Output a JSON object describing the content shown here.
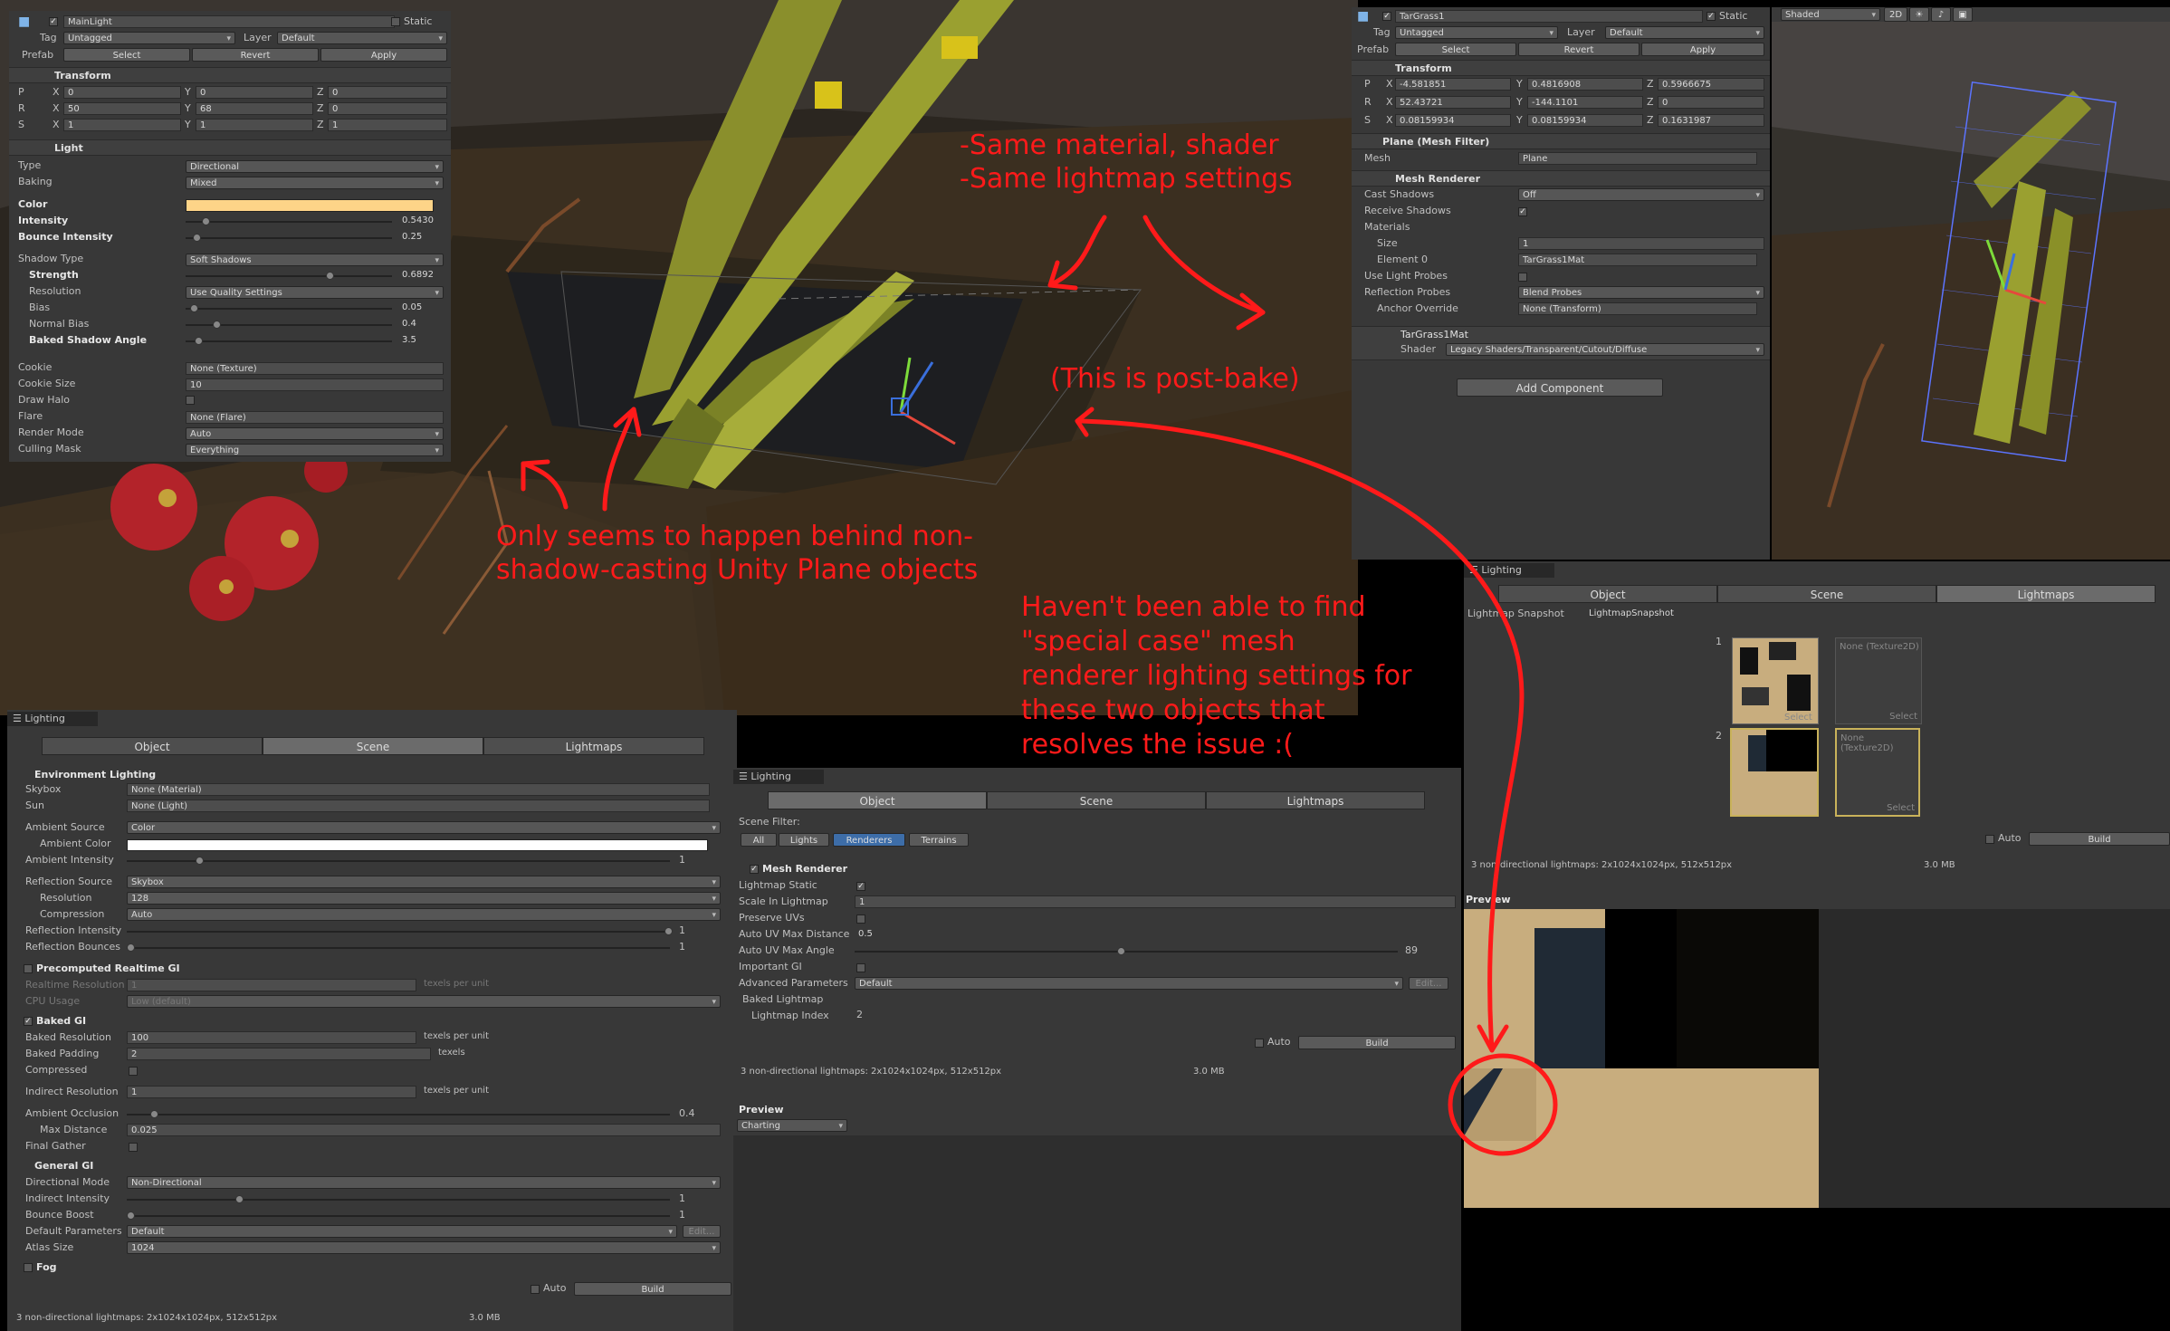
{
  "colors": {
    "annotation": "#ff1a1a",
    "light_color": "#fdd488",
    "panel": "#383838"
  },
  "main_light": {
    "name": "MainLight",
    "static": "Static",
    "tag_label": "Tag",
    "tag": "Untagged",
    "layer_label": "Layer",
    "layer": "Default",
    "prefab_label": "Prefab",
    "select": "Select",
    "revert": "Revert",
    "apply": "Apply",
    "transform_title": "Transform",
    "p": [
      "P",
      "X",
      "0",
      "Y",
      "0",
      "Z",
      "0"
    ],
    "r": [
      "R",
      "X",
      "50",
      "Y",
      "68",
      "Z",
      "0"
    ],
    "s": [
      "S",
      "X",
      "1",
      "Y",
      "1",
      "Z",
      "1"
    ],
    "light_title": "Light",
    "type_label": "Type",
    "type": "Directional",
    "baking_label": "Baking",
    "baking": "Mixed",
    "color_label": "Color",
    "intensity_label": "Intensity",
    "intensity": "0.5430",
    "bounce_label": "Bounce Intensity",
    "bounce": "0.25",
    "shadow_type_label": "Shadow Type",
    "shadow_type": "Soft Shadows",
    "strength_label": "Strength",
    "strength": "0.6892",
    "resolution_label": "Resolution",
    "resolution": "Use Quality Settings",
    "bias_label": "Bias",
    "bias": "0.05",
    "normal_bias_label": "Normal Bias",
    "normal_bias": "0.4",
    "baked_angle_label": "Baked Shadow Angle",
    "baked_angle": "3.5",
    "cookie_label": "Cookie",
    "cookie": "None (Texture)",
    "cookie_size_label": "Cookie Size",
    "cookie_size": "10",
    "draw_halo_label": "Draw Halo",
    "flare_label": "Flare",
    "flare": "None (Flare)",
    "render_mode_label": "Render Mode",
    "render_mode": "Auto",
    "culling_label": "Culling Mask",
    "culling": "Everything"
  },
  "tar_grass": {
    "name": "TarGrass1",
    "static": "Static",
    "tag_label": "Tag",
    "tag": "Untagged",
    "layer_label": "Layer",
    "layer": "Default",
    "prefab_label": "Prefab",
    "select": "Select",
    "revert": "Revert",
    "apply": "Apply",
    "transform_title": "Transform",
    "p": [
      "P",
      "X",
      "-4.581851",
      "Y",
      "0.4816908",
      "Z",
      "0.5966675"
    ],
    "r": [
      "R",
      "X",
      "52.43721",
      "Y",
      "-144.1101",
      "Z",
      "0"
    ],
    "s": [
      "S",
      "X",
      "0.08159934",
      "Y",
      "0.08159934",
      "Z",
      "0.1631987"
    ],
    "mesh_filter_title": "Plane (Mesh Filter)",
    "mesh_label": "Mesh",
    "mesh": "Plane",
    "renderer_title": "Mesh Renderer",
    "cast_label": "Cast Shadows",
    "cast": "Off",
    "receive_label": "Receive Shadows",
    "materials_label": "Materials",
    "size_label": "Size",
    "size": "1",
    "element_label": "Element 0",
    "element": "TarGrass1Mat",
    "light_probes_label": "Use Light Probes",
    "refl_probes_label": "Reflection Probes",
    "refl_probes": "Blend Probes",
    "anchor_label": "Anchor Override",
    "anchor": "None (Transform)",
    "material_name": "TarGrass1Mat",
    "shader_label": "Shader",
    "shader": "Legacy Shaders/Transparent/Cutout/Diffuse",
    "add_component": "Add Component"
  },
  "scene_view": {
    "shaded": "Shaded",
    "mode_2d": "2D"
  },
  "lighting_scene": {
    "title": "Lighting",
    "tabs": [
      "Object",
      "Scene",
      "Lightmaps"
    ],
    "env_title": "Environment Lighting",
    "skybox_label": "Skybox",
    "skybox": "None (Material)",
    "sun_label": "Sun",
    "sun": "None (Light)",
    "amb_source_label": "Ambient Source",
    "amb_source": "Color",
    "amb_color_label": "Ambient Color",
    "amb_intensity_label": "Ambient Intensity",
    "amb_intensity": "1",
    "refl_source_label": "Reflection Source",
    "refl_source": "Skybox",
    "refl_res_label": "Resolution",
    "refl_res": "128",
    "compression_label": "Compression",
    "compression": "Auto",
    "refl_intensity_label": "Reflection Intensity",
    "refl_intensity": "1",
    "refl_bounces_label": "Reflection Bounces",
    "refl_bounces": "1",
    "precomp_title": "Precomputed Realtime GI",
    "rt_res_label": "Realtime Resolution",
    "rt_res": "1",
    "texels": "texels per unit",
    "cpu_label": "CPU Usage",
    "cpu": "Low (default)",
    "baked_title": "Baked GI",
    "baked_res_label": "Baked Resolution",
    "baked_res": "100",
    "baked_pad_label": "Baked Padding",
    "baked_pad": "2",
    "texels_unit": "texels",
    "compressed_label": "Compressed",
    "indirect_res_label": "Indirect Resolution",
    "indirect_res": "1",
    "ao_label": "Ambient Occlusion",
    "ao": "0.4",
    "max_dist_label": "Max Distance",
    "max_dist": "0.025",
    "final_gather_label": "Final Gather",
    "general_title": "General GI",
    "dir_mode_label": "Directional Mode",
    "dir_mode": "Non-Directional",
    "indirect_int_label": "Indirect Intensity",
    "indirect_int": "1",
    "bounce_boost_label": "Bounce Boost",
    "bounce_boost": "1",
    "default_params_label": "Default Parameters",
    "default_params": "Default",
    "edit": "Edit...",
    "atlas_label": "Atlas Size",
    "atlas": "1024",
    "fog_title": "Fog",
    "auto": "Auto",
    "build": "Build",
    "status": "3 non-directional lightmaps: 2x1024x1024px, 512x512px",
    "size": "3.0 MB"
  },
  "lighting_object": {
    "title": "Lighting",
    "tabs": [
      "Object",
      "Scene",
      "Lightmaps"
    ],
    "filter_label": "Scene Filter:",
    "filters": [
      "All",
      "Lights",
      "Renderers",
      "Terrains"
    ],
    "renderer_title": "Mesh Renderer",
    "lm_static_label": "Lightmap Static",
    "scale_label": "Scale In Lightmap",
    "scale": "1",
    "preserve_label": "Preserve UVs",
    "max_dist_label": "Auto UV Max Distance",
    "max_dist": "0.5",
    "max_angle_label": "Auto UV Max Angle",
    "max_angle": "89",
    "important_label": "Important GI",
    "adv_label": "Advanced Parameters",
    "adv": "Default",
    "edit": "Edit...",
    "baked_lm_label": "Baked Lightmap",
    "lm_index_label": "Lightmap Index",
    "lm_index": "2",
    "auto": "Auto",
    "build": "Build",
    "status": "3 non-directional lightmaps: 2x1024x1024px, 512x512px",
    "size": "3.0 MB",
    "preview_label": "Preview",
    "charting": "Charting"
  },
  "lighting_lightmaps": {
    "title": "Lighting",
    "tabs": [
      "Object",
      "Scene",
      "Lightmaps"
    ],
    "snapshot_label": "Lightmap Snapshot",
    "snapshot": "LightmapSnapshot",
    "idx1": "1",
    "idx2": "2",
    "none_tex": "None (Texture2D)",
    "select": "Select",
    "auto": "Auto",
    "build": "Build",
    "status": "3 non-directional lightmaps: 2x1024x1024px, 512x512px",
    "size": "3.0 MB",
    "preview_label": "Preview"
  },
  "annotations": {
    "material_1": "-Same material, shader",
    "material_2": "-Same lightmap settings",
    "post_bake": "(This is post-bake)",
    "behind_1": "Only seems to happen behind non-",
    "behind_2": "shadow-casting Unity Plane objects",
    "settings_1": "Haven't been able to find",
    "settings_2": "\"special case\" mesh",
    "settings_3": "renderer lighting settings for",
    "settings_4": "these two objects that",
    "settings_5": "resolves the issue :("
  }
}
